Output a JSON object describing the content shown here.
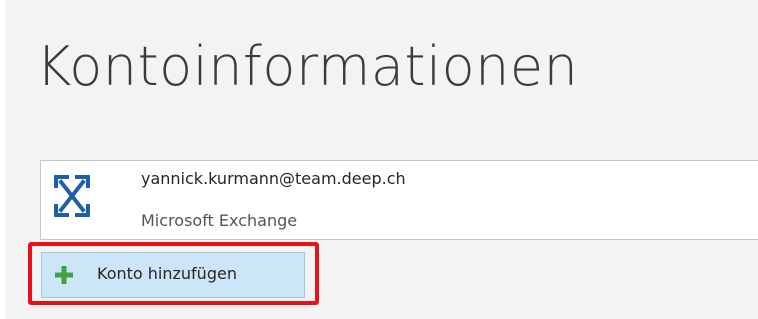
{
  "page": {
    "title": "Kontoinformationen"
  },
  "account": {
    "email": "yannick.kurmann@team.deep.ch",
    "type": "Microsoft Exchange",
    "icon": "exchange-icon"
  },
  "actions": {
    "add_account_label": "Konto hinzufügen",
    "add_account_icon": "plus-icon"
  },
  "colors": {
    "background": "#f3f3f3",
    "exchange_icon": "#1f5ea8",
    "plus_icon": "#3fa33f",
    "button_background": "#cde6f7",
    "highlight_frame": "#e8111b"
  }
}
